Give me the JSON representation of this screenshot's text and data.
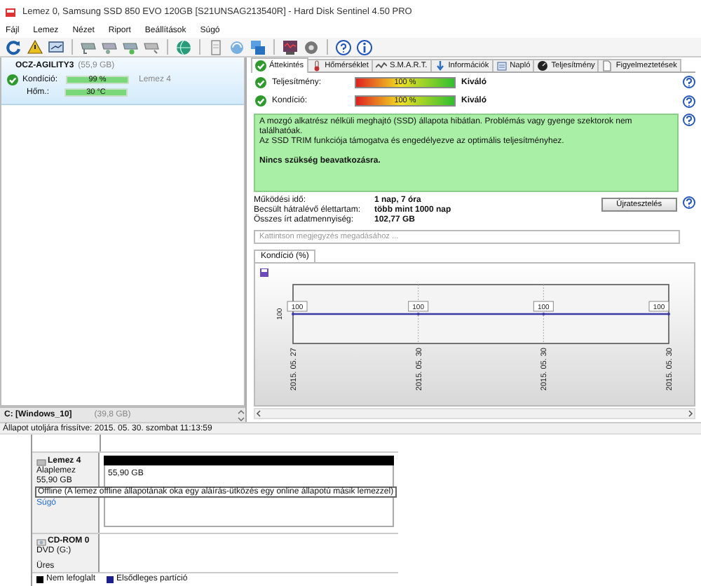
{
  "window": {
    "title": "Lemez 0, Samsung SSD 850 EVO 120GB [S21UNSAG213540R]  -  Hard Disk Sentinel 4.50 PRO"
  },
  "menu": [
    "Fájl",
    "Lemez",
    "Nézet",
    "Riport",
    "Beállítások",
    "Súgó"
  ],
  "disk_list": {
    "disks": [
      {
        "name": "OCZ-AGILITY3",
        "size": "(55,9 GB)",
        "selected": true,
        "condition": {
          "label": "Kondíció:",
          "value": "99 %",
          "level": 0.99
        },
        "disk_ref": "Lemez 4",
        "temperature": {
          "label": "Hőm.:",
          "value": "30 °C",
          "level": 1
        }
      }
    ],
    "partition": {
      "name": "C: [Windows_10]",
      "size": "(39,8 GB)"
    }
  },
  "tabs": [
    {
      "label": "Áttekintés",
      "selected": true
    },
    {
      "label": "Hőmérséklet",
      "selected": false
    },
    {
      "label": "S.M.A.R.T.",
      "selected": false
    },
    {
      "label": "Információk",
      "selected": false
    },
    {
      "label": "Napló",
      "selected": false
    },
    {
      "label": "Teljesítmény",
      "selected": false
    },
    {
      "label": "Figyelmeztetések",
      "selected": false
    }
  ],
  "overview": {
    "metrics": [
      {
        "label": "Teljesítmény:",
        "value": "100 %",
        "level": 1,
        "rating": "Kiváló"
      },
      {
        "label": "Kondíció:",
        "value": "100 %",
        "level": 1,
        "rating": "Kiváló"
      }
    ],
    "message": {
      "lines": [
        "A mozgó alkatrész nélküli meghajtó (SSD) állapota hibátlan. Problémás vagy gyenge szektorok nem találhatóak.",
        "Az SSD TRIM funkciója támogatva és engedélyezve az optimális teljesítményhez."
      ],
      "advice": "Nincs szükség beavatkozásra."
    },
    "stats": [
      {
        "label": "Működési idő:",
        "value": "1 nap, 7 óra"
      },
      {
        "label": "Becsült hátralévő élettartam:",
        "value": "több mint 1000 nap"
      },
      {
        "label": "Összes írt adatmennyiség:",
        "value": "102,77 GB"
      }
    ],
    "retest_button": "Újratesztelés",
    "note_field": {
      "placeholder": "Kattintson megjegyzés megadásához ..."
    },
    "chart_tabs": [
      {
        "label": "Kondíció  (%)",
        "selected": true
      }
    ],
    "condition_chart": {
      "y_axis_label": "100",
      "points": [
        {
          "date": "2015. 05. 27",
          "label": "100"
        },
        {
          "date": "2015. 05. 30",
          "label": "100"
        },
        {
          "date": "2015. 05. 30",
          "label": "100"
        },
        {
          "date": "2015. 05. 30",
          "label": "100"
        }
      ]
    }
  },
  "status_bar": "Állapot utoljára frissítve: 2015. 05. 30. szombat 11:13:59",
  "disk_management": {
    "disks": [
      {
        "kind": "disk",
        "name": "Lemez 4",
        "type": "Alaplemez",
        "size": "55,90 GB",
        "partition_size": "55,90 GB",
        "tooltip": "Offline (A lemez offline állapotának oka egy aláírás-ütközés egy online állapotú másik lemezzel)",
        "link": "Súgó"
      },
      {
        "kind": "cdrom",
        "name": "CD-ROM 0",
        "type": "DVD (G:)",
        "status": "Üres"
      }
    ],
    "legend": [
      {
        "label": "Nem lefoglalt",
        "color": "#000000"
      },
      {
        "label": "Elsődleges partíció",
        "color": "#1a1f8c"
      }
    ]
  }
}
